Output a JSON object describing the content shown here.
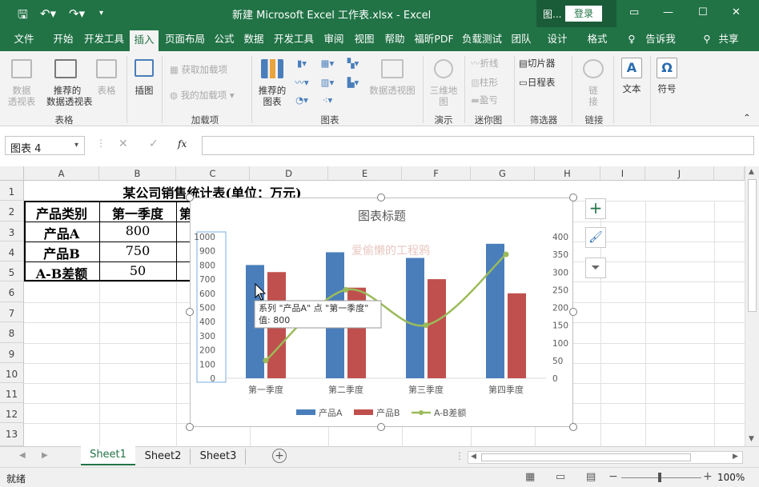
{
  "window": {
    "title": "新建 Microsoft Excel 工作表.xlsx  -  Excel",
    "context_tab": "图...",
    "login": "登录"
  },
  "tabs": [
    "文件",
    "开始",
    "开发工具",
    "插入",
    "页面布局",
    "公式",
    "数据",
    "开发工具",
    "审阅",
    "视图",
    "帮助",
    "福昕PDF",
    "负载测试",
    "团队",
    "设计",
    "格式"
  ],
  "tell_me": "告诉我",
  "share": "共享",
  "ribbon": {
    "pivot": "数据\n透视表",
    "recommended_pivot": "推荐的\n数据透视表",
    "table": "表格",
    "illustration": "插图",
    "get_addins": "获取加载项",
    "my_addins": "我的加载项",
    "recommended_charts": "推荐的\n图表",
    "pivot_chart": "数据透视图",
    "map3d": "三维地\n图",
    "spark_line": "折线",
    "spark_col": "柱形",
    "spark_wl": "盈亏",
    "slicer": "切片器",
    "timeline": "日程表",
    "link": "链\n接",
    "text": "文本",
    "symbol": "符号",
    "groups": {
      "tables": "表格",
      "addins": "加载项",
      "charts": "图表",
      "tours": "演示",
      "sparklines": "迷你图",
      "filters": "筛选器",
      "links": "链接"
    }
  },
  "formula_bar": {
    "name_box": "图表 4",
    "fx": "fx",
    "formula": ""
  },
  "columns": [
    "A",
    "B",
    "C",
    "D",
    "E",
    "F",
    "G",
    "H",
    "I",
    "J"
  ],
  "rows": [
    "1",
    "2",
    "3",
    "4",
    "5",
    "6",
    "7",
    "8",
    "9",
    "10",
    "11",
    "12",
    "13"
  ],
  "sheet": {
    "title": "某公司销售统计表(单位：万元)",
    "headers": [
      "产品类别",
      "第一季度",
      "第"
    ],
    "rows": [
      {
        "label": "产品A",
        "value": "800"
      },
      {
        "label": "产品B",
        "value": "750"
      },
      {
        "label": "A-B差额",
        "value": "50"
      }
    ]
  },
  "watermark": "爱偷懒的工程鸦",
  "chart_data": {
    "type": "bar",
    "title": "图表标题",
    "categories": [
      "第一季度",
      "第二季度",
      "第三季度",
      "第四季度"
    ],
    "series": [
      {
        "name": "产品A",
        "type": "bar",
        "axis": "primary",
        "color": "#4a7ebb",
        "values": [
          800,
          890,
          850,
          950
        ]
      },
      {
        "name": "产品B",
        "type": "bar",
        "axis": "primary",
        "color": "#c0504d",
        "values": [
          750,
          640,
          700,
          600
        ]
      },
      {
        "name": "A-B差额",
        "type": "line",
        "axis": "secondary",
        "color": "#9bbb59",
        "values": [
          50,
          250,
          150,
          350
        ]
      }
    ],
    "primary_ticks": [
      "0",
      "100",
      "200",
      "300",
      "400",
      "500",
      "600",
      "700",
      "800",
      "900",
      "1000"
    ],
    "secondary_ticks": [
      "0",
      "50",
      "100",
      "150",
      "200",
      "250",
      "300",
      "350",
      "400"
    ],
    "ylim": [
      0,
      1000
    ],
    "y2lim": [
      0,
      400
    ],
    "legend_position": "bottom",
    "tooltip": {
      "line1": "系列 \"产品A\" 点 \"第一季度\"",
      "line2": "值: 800"
    }
  },
  "sheet_tabs": [
    "Sheet1",
    "Sheet2",
    "Sheet3"
  ],
  "status": {
    "ready": "就绪",
    "zoom": "100%"
  }
}
